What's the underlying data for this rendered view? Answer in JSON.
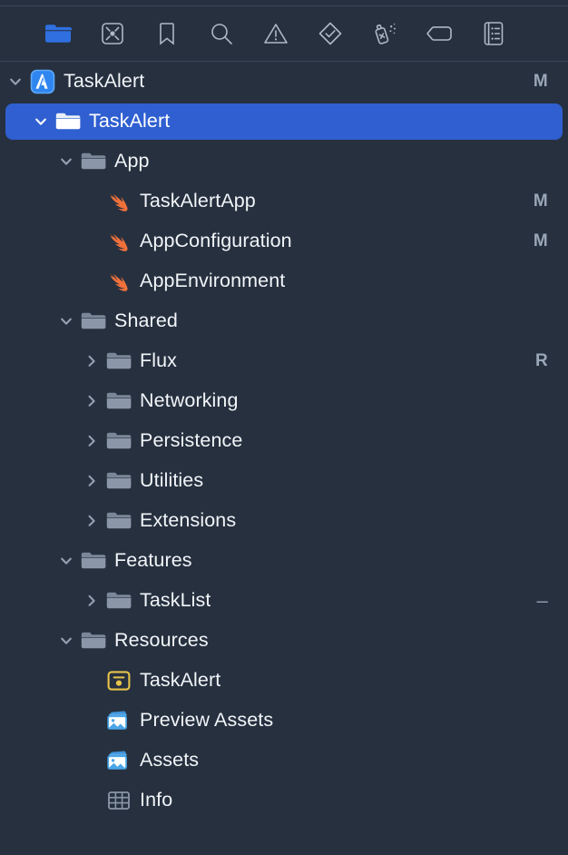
{
  "window": {
    "panel_name": "Project Navigator",
    "background_color": "#26303f",
    "selection_color": "#2f5fd0"
  },
  "nav_toolbar": {
    "tabs": [
      {
        "name": "project-navigator",
        "icon": "folder-icon",
        "label": "Project",
        "active": true
      },
      {
        "name": "source-control-navigator",
        "icon": "source-control-icon",
        "label": "Source Control",
        "active": false
      },
      {
        "name": "bookmark-navigator",
        "icon": "bookmark-icon",
        "label": "Bookmarks",
        "active": false
      },
      {
        "name": "find-navigator",
        "icon": "search-icon",
        "label": "Find",
        "active": false
      },
      {
        "name": "issue-navigator",
        "icon": "warning-triangle-icon",
        "label": "Issues",
        "active": false
      },
      {
        "name": "test-navigator",
        "icon": "diamond-check-icon",
        "label": "Tests",
        "active": false
      },
      {
        "name": "debug-navigator",
        "icon": "spray-can-icon",
        "label": "Debug",
        "active": false
      },
      {
        "name": "breakpoint-navigator",
        "icon": "tag-icon",
        "label": "Breakpoints",
        "active": false
      },
      {
        "name": "report-navigator",
        "icon": "report-list-icon",
        "label": "Reports",
        "active": false
      }
    ]
  },
  "tree": {
    "rows": [
      {
        "label": "TaskAlert",
        "depth": 0,
        "icon": "xcode-project-icon",
        "twisty": "open",
        "badge": "M",
        "selected": false
      },
      {
        "label": "TaskAlert",
        "depth": 1,
        "icon": "folder-icon",
        "twisty": "open",
        "badge": "",
        "selected": true
      },
      {
        "label": "App",
        "depth": 2,
        "icon": "folder-icon",
        "twisty": "open",
        "badge": "",
        "selected": false
      },
      {
        "label": "TaskAlertApp",
        "depth": 3,
        "icon": "swift-file-icon",
        "twisty": "none",
        "badge": "M",
        "selected": false
      },
      {
        "label": "AppConfiguration",
        "depth": 3,
        "icon": "swift-file-icon",
        "twisty": "none",
        "badge": "M",
        "selected": false
      },
      {
        "label": "AppEnvironment",
        "depth": 3,
        "icon": "swift-file-icon",
        "twisty": "none",
        "badge": "",
        "selected": false
      },
      {
        "label": "Shared",
        "depth": 2,
        "icon": "folder-icon",
        "twisty": "open",
        "badge": "",
        "selected": false
      },
      {
        "label": "Flux",
        "depth": 3,
        "icon": "folder-icon",
        "twisty": "closed",
        "badge": "R",
        "selected": false
      },
      {
        "label": "Networking",
        "depth": 3,
        "icon": "folder-icon",
        "twisty": "closed",
        "badge": "",
        "selected": false
      },
      {
        "label": "Persistence",
        "depth": 3,
        "icon": "folder-icon",
        "twisty": "closed",
        "badge": "",
        "selected": false
      },
      {
        "label": "Utilities",
        "depth": 3,
        "icon": "folder-icon",
        "twisty": "closed",
        "badge": "",
        "selected": false
      },
      {
        "label": "Extensions",
        "depth": 3,
        "icon": "folder-icon",
        "twisty": "closed",
        "badge": "",
        "selected": false
      },
      {
        "label": "Features",
        "depth": 2,
        "icon": "folder-icon",
        "twisty": "open",
        "badge": "",
        "selected": false
      },
      {
        "label": "TaskList",
        "depth": 3,
        "icon": "folder-icon",
        "twisty": "closed",
        "badge": "–",
        "selected": false
      },
      {
        "label": "Resources",
        "depth": 2,
        "icon": "folder-icon",
        "twisty": "open",
        "badge": "",
        "selected": false
      },
      {
        "label": "TaskAlert",
        "depth": 3,
        "icon": "entitlements-icon",
        "twisty": "none",
        "badge": "",
        "selected": false
      },
      {
        "label": "Preview Assets",
        "depth": 3,
        "icon": "asset-catalog-icon",
        "twisty": "none",
        "badge": "",
        "selected": false
      },
      {
        "label": "Assets",
        "depth": 3,
        "icon": "asset-catalog-icon",
        "twisty": "none",
        "badge": "",
        "selected": false
      },
      {
        "label": "Info",
        "depth": 3,
        "icon": "plist-icon",
        "twisty": "none",
        "badge": "",
        "selected": false
      }
    ]
  },
  "colors": {
    "swift_orange": "#f0713a",
    "folder_gray": "#8b97a8",
    "asset_blue": "#4aa6e8",
    "entitlement_yellow": "#e8c44a",
    "project_blue": "#2f86f0",
    "badge_gray": "#9aa7b8"
  }
}
